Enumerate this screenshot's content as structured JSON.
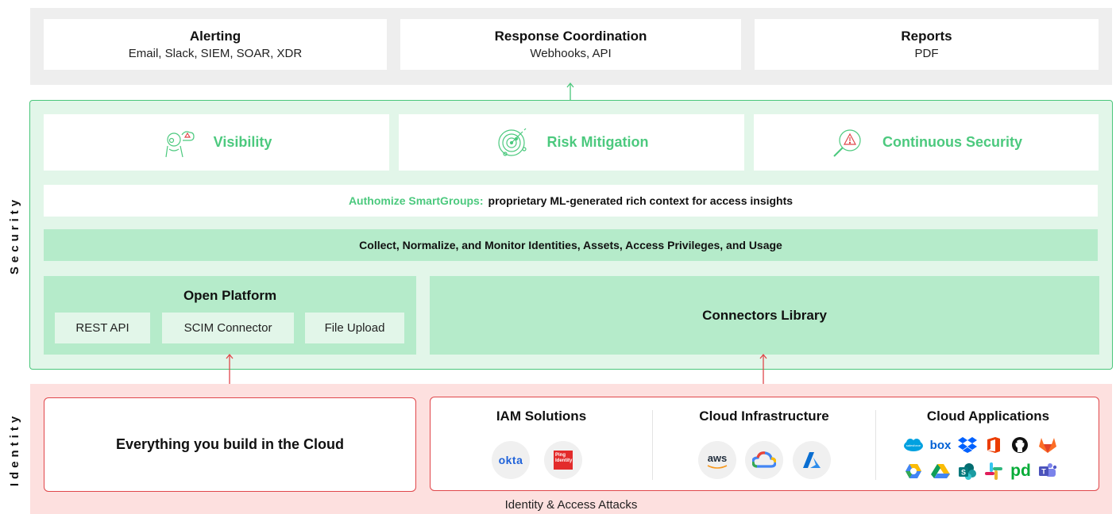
{
  "side_labels": {
    "security": "Security",
    "identity": "Identity"
  },
  "outputs": [
    {
      "title": "Alerting",
      "sub": "Email, Slack, SIEM, SOAR, XDR"
    },
    {
      "title": "Response Coordination",
      "sub": "Webhooks, API"
    },
    {
      "title": "Reports",
      "sub": "PDF"
    }
  ],
  "features": [
    {
      "label": "Visibility",
      "icon": "visibility-person-icon"
    },
    {
      "label": "Risk Mitigation",
      "icon": "radar-icon"
    },
    {
      "label": "Continuous Security",
      "icon": "magnifier-warning-icon"
    }
  ],
  "smartgroups": {
    "brand": "Authomize SmartGroups:",
    "text": "proprietary ML-generated rich context for access insights"
  },
  "collect": "Collect, Normalize, and Monitor Identities, Assets, Access Privileges, and Usage",
  "open_platform": {
    "title": "Open Platform",
    "items": [
      "REST API",
      "SCIM Connector",
      "File Upload"
    ]
  },
  "connectors_library": "Connectors Library",
  "build_cloud": "Everything you build in the Cloud",
  "categories": {
    "iam": {
      "title": "IAM Solutions",
      "logos": [
        "okta",
        "Ping Identity"
      ]
    },
    "infra": {
      "title": "Cloud Infrastructure",
      "logos": [
        "aws",
        "google-cloud-icon",
        "azure-icon"
      ]
    },
    "apps": {
      "title": "Cloud Applications",
      "logos": [
        "salesforce",
        "box",
        "dropbox-icon",
        "office-icon",
        "github-icon",
        "gitlab-icon",
        "gcp-icon",
        "google-drive-icon",
        "sharepoint-icon",
        "slack-icon",
        "pd",
        "teams-icon"
      ]
    }
  },
  "attacks": "Identity & Access Attacks",
  "colors": {
    "green_accent": "#4cc97e",
    "green_border": "#49c67a",
    "green_light": "#e2f6e9",
    "green_mid": "#b5ebca",
    "red_border": "#e0464a",
    "red_light": "#fde0df",
    "gray_band": "#eeeeee"
  }
}
